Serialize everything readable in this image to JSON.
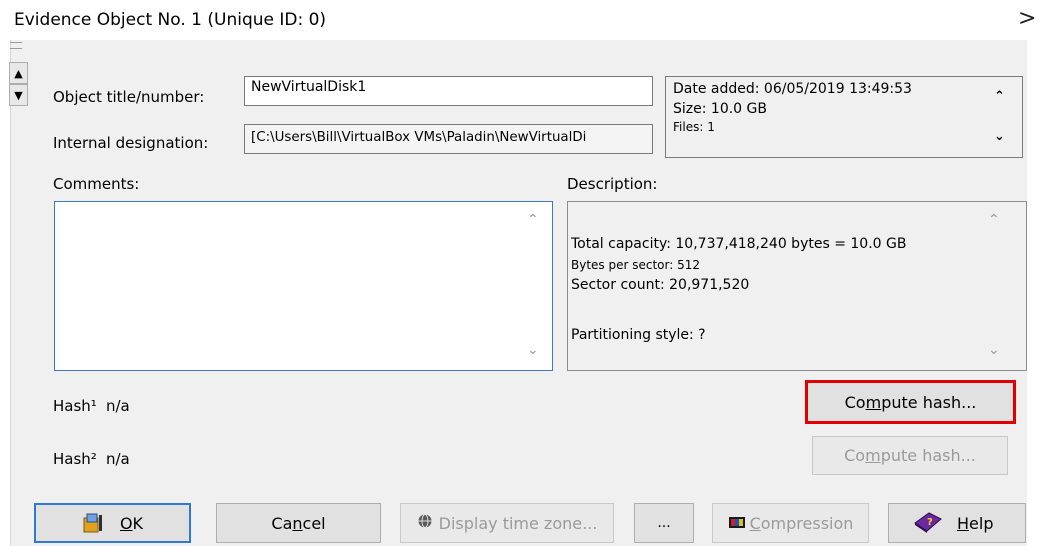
{
  "window": {
    "title": "Evidence Object No. 1 (Unique ID: 0)",
    "close_glyph": ">"
  },
  "fields": {
    "object_title_label": "Object title/number:",
    "object_title_value": "NewVirtualDisk1",
    "internal_designation_label": "Internal designation:",
    "internal_designation_value": "[C:\\Users\\Bill\\VirtualBox VMs\\Paladin\\NewVirtualDi",
    "comments_label": "Comments:",
    "comments_value": "",
    "description_label": "Description:"
  },
  "info_box": {
    "line1": "Date added: 06/05/2019  13:49:53",
    "line2": "Size: 10.0 GB",
    "line3": "Files: 1"
  },
  "description": {
    "line1": "Total capacity: 10,737,418,240 bytes = 10.0 GB",
    "line2": "Bytes per sector: 512",
    "line3": "Sector count: 20,971,520",
    "line4": "Partitioning style: ?"
  },
  "hashes": {
    "hash1_label": "Hash¹",
    "hash1_value": "n/a",
    "hash2_label": "Hash²",
    "hash2_value": "n/a",
    "compute1_pre": "Co",
    "compute1_key": "m",
    "compute1_post": "pute hash...",
    "compute2_pre": "Co",
    "compute2_key": "m",
    "compute2_post": "pute hash...",
    "highlight_color": "#e00000"
  },
  "buttons": {
    "ok_key": "O",
    "ok_rest": "K",
    "cancel_pre": "Ca",
    "cancel_key": "n",
    "cancel_post": "cel",
    "display_tz": "Display time zone...",
    "ellipsis": "...",
    "compression_key": "C",
    "compression_rest": "ompression",
    "help_key": "H",
    "help_rest": "elp"
  },
  "icons": {
    "ok": "ok-icon",
    "display_tz": "globe-icon",
    "compression": "compression-icon",
    "help": "help-book-icon"
  }
}
